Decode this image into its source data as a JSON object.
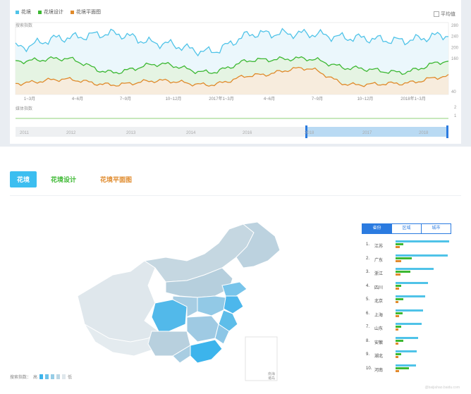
{
  "top_chart": {
    "legend": [
      {
        "label": "花境",
        "color": "#4fc3e8"
      },
      {
        "label": "花境设计",
        "color": "#3cb832"
      },
      {
        "label": "花境平面图",
        "color": "#e08a2b"
      }
    ],
    "avg_label": "平均值",
    "search_label": "搜索指数",
    "media_label": "媒体指数",
    "y_ticks": [
      "280",
      "240",
      "200",
      "160",
      "40"
    ],
    "media_ticks": [
      "2",
      "1"
    ],
    "x_ticks": [
      "1~3月",
      "4~6月",
      "7~9月",
      "10~12月",
      "2017年1~3月",
      "4~6月",
      "7~9月",
      "10~12月",
      "2018年1~3月"
    ],
    "timeline_years": [
      "2011",
      "2012",
      "2013",
      "2014",
      "2016",
      "2018",
      "2017",
      "2018"
    ]
  },
  "chart_data": {
    "type": "line",
    "title": "",
    "x": [
      "1~3月",
      "4~6月",
      "7~9月",
      "10~12月",
      "2017年1~3月",
      "4~6月",
      "7~9月",
      "10~12月",
      "2018年1~3月"
    ],
    "ylabel": "搜索指数",
    "series": [
      {
        "name": "花境",
        "values": [
          200,
          235,
          250,
          215,
          185,
          250,
          250,
          235,
          225,
          245
        ]
      },
      {
        "name": "花境设计",
        "values": [
          150,
          160,
          110,
          140,
          110,
          155,
          160,
          125,
          110,
          150
        ]
      },
      {
        "name": "花境平面图",
        "values": [
          70,
          85,
          65,
          80,
          65,
          100,
          125,
          65,
          70,
          95
        ]
      }
    ]
  },
  "tabs": [
    {
      "label": "花境",
      "color": "#ffffff"
    },
    {
      "label": "花境设计",
      "color": "#3cb832"
    },
    {
      "label": "花境平面图",
      "color": "#e08a2b"
    }
  ],
  "map": {
    "legend_label": "搜索指数：",
    "legend_high": "高",
    "legend_low": "低",
    "inset_label": "南海\n诸岛"
  },
  "ranking": {
    "tabs": [
      "省份",
      "区域",
      "城市"
    ],
    "rows": [
      {
        "rank": "1.",
        "name": "江苏",
        "a": 1.0,
        "b": 0.15,
        "c": 0.08
      },
      {
        "rank": "2.",
        "name": "广东",
        "a": 0.97,
        "b": 0.3,
        "c": 0.1
      },
      {
        "rank": "3.",
        "name": "浙江",
        "a": 0.71,
        "b": 0.27,
        "c": 0.09
      },
      {
        "rank": "4.",
        "name": "四川",
        "a": 0.6,
        "b": 0.11,
        "c": 0.06
      },
      {
        "rank": "5.",
        "name": "北京",
        "a": 0.55,
        "b": 0.14,
        "c": 0.05
      },
      {
        "rank": "6.",
        "name": "上海",
        "a": 0.51,
        "b": 0.13,
        "c": 0.06
      },
      {
        "rank": "7.",
        "name": "山东",
        "a": 0.48,
        "b": 0.1,
        "c": 0.05
      },
      {
        "rank": "8.",
        "name": "安徽",
        "a": 0.42,
        "b": 0.14,
        "c": 0.05
      },
      {
        "rank": "9.",
        "name": "湖北",
        "a": 0.4,
        "b": 0.11,
        "c": 0.05
      },
      {
        "rank": "10.",
        "name": "河南",
        "a": 0.38,
        "b": 0.25,
        "c": 0.07
      }
    ]
  },
  "watermark": "@baijiahao.baidu.com"
}
